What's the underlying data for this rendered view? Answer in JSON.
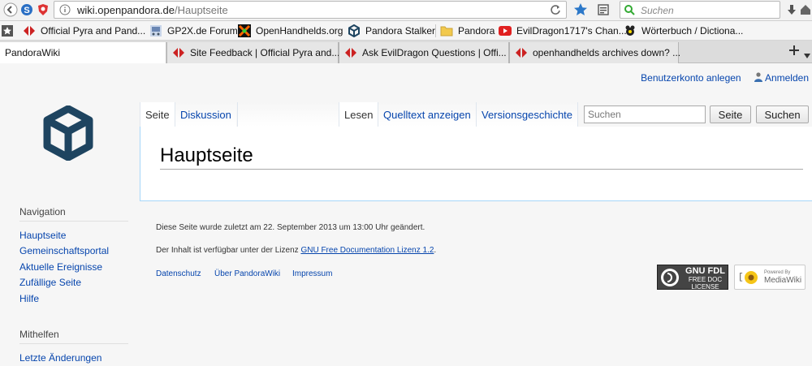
{
  "browser": {
    "url_domain": "wiki.openpandora.de",
    "url_path": "/Hauptseite",
    "search_placeholder": "Suchen"
  },
  "bookmarks": [
    {
      "label": "Official Pyra and Pand...",
      "icon": "pyra-icon"
    },
    {
      "label": "GP2X.de Forum",
      "icon": "gp2x-icon"
    },
    {
      "label": "OpenHandhelds.org",
      "icon": "openhandhelds-icon"
    },
    {
      "label": "Pandora Stalker",
      "icon": "pandora-stalker-icon"
    },
    {
      "label": "Pandora",
      "icon": "folder-icon"
    },
    {
      "label": "EvilDragon1717's Chan...",
      "icon": "youtube-icon"
    },
    {
      "label": "Wörterbuch / Dictiona...",
      "icon": "dictionary-icon"
    }
  ],
  "tabs": [
    {
      "label": "PandoraWiki",
      "active": true
    },
    {
      "label": "Site Feedback | Official Pyra and...",
      "active": false
    },
    {
      "label": "Ask EvilDragon Questions | Offi...",
      "active": false
    },
    {
      "label": "openhandhelds archives down? ...",
      "active": false
    }
  ],
  "personal": {
    "create_account": "Benutzerkonto anlegen",
    "login": "Anmelden"
  },
  "namespaces": {
    "page": "Seite",
    "discussion": "Diskussion"
  },
  "views": {
    "read": "Lesen",
    "view_source": "Quelltext anzeigen",
    "history": "Versionsgeschichte"
  },
  "search": {
    "placeholder": "Suchen",
    "go_button": "Seite",
    "search_button": "Suchen"
  },
  "page_title": "Hauptseite",
  "sidebar": {
    "navigation_title": "Navigation",
    "navigation_items": [
      "Hauptseite",
      "Gemeinschaftsportal",
      "Aktuelle Ereignisse",
      "Zufällige Seite",
      "Hilfe"
    ],
    "contribute_title": "Mithelfen",
    "contribute_items": [
      "Letzte Änderungen"
    ]
  },
  "footer": {
    "last_modified": "Diese Seite wurde zuletzt am 22. September 2013 um 13:00 Uhr geändert.",
    "license_prefix": "Der Inhalt ist verfügbar unter der Lizenz",
    "license_link": "GNU Free Documentation Lizenz 1.2",
    "license_suffix": ".",
    "links": [
      "Datenschutz",
      "Über PandoraWiki",
      "Impressum"
    ],
    "gfdl_badge": [
      "GNU FDL",
      "FREE DOC",
      "LICENSE"
    ],
    "mediawiki_badge": [
      "Powered By",
      "MediaWiki"
    ]
  },
  "colors": {
    "link": "#0645ad",
    "logo": "#1e4460",
    "content_border": "#a7d7f9"
  }
}
